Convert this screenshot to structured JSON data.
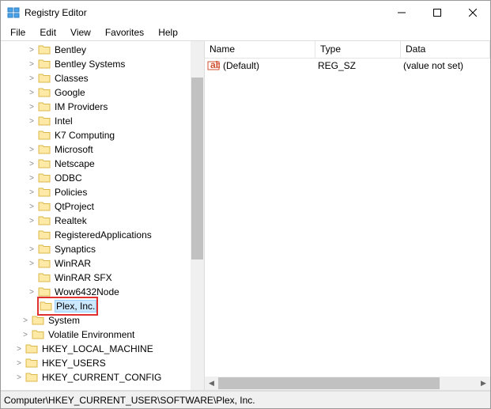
{
  "window": {
    "title": "Registry Editor"
  },
  "menu": {
    "file": "File",
    "edit": "Edit",
    "view": "View",
    "favorites": "Favorites",
    "help": "Help"
  },
  "tree": {
    "items": [
      {
        "label": "Bentley",
        "expandable": true,
        "depth": 4,
        "last": false
      },
      {
        "label": "Bentley Systems",
        "expandable": true,
        "depth": 4,
        "last": false
      },
      {
        "label": "Classes",
        "expandable": true,
        "depth": 4,
        "last": false
      },
      {
        "label": "Google",
        "expandable": true,
        "depth": 4,
        "last": false
      },
      {
        "label": "IM Providers",
        "expandable": true,
        "depth": 4,
        "last": false
      },
      {
        "label": "Intel",
        "expandable": true,
        "depth": 4,
        "last": false
      },
      {
        "label": "K7 Computing",
        "expandable": false,
        "depth": 4,
        "last": false
      },
      {
        "label": "Microsoft",
        "expandable": true,
        "depth": 4,
        "last": false
      },
      {
        "label": "Netscape",
        "expandable": true,
        "depth": 4,
        "last": false
      },
      {
        "label": "ODBC",
        "expandable": true,
        "depth": 4,
        "last": false
      },
      {
        "label": "Policies",
        "expandable": true,
        "depth": 4,
        "last": false
      },
      {
        "label": "QtProject",
        "expandable": true,
        "depth": 4,
        "last": false
      },
      {
        "label": "Realtek",
        "expandable": true,
        "depth": 4,
        "last": false
      },
      {
        "label": "RegisteredApplications",
        "expandable": false,
        "depth": 4,
        "last": false
      },
      {
        "label": "Synaptics",
        "expandable": true,
        "depth": 4,
        "last": false
      },
      {
        "label": "WinRAR",
        "expandable": true,
        "depth": 4,
        "last": false
      },
      {
        "label": "WinRAR SFX",
        "expandable": false,
        "depth": 4,
        "last": false
      },
      {
        "label": "Wow6432Node",
        "expandable": true,
        "depth": 4,
        "last": false
      },
      {
        "label": "Plex, Inc.",
        "expandable": false,
        "depth": 4,
        "last": true,
        "selected": true,
        "highlight": true
      },
      {
        "label": "System",
        "expandable": true,
        "depth": 3,
        "last": false
      },
      {
        "label": "Volatile Environment",
        "expandable": true,
        "depth": 3,
        "last": true
      },
      {
        "label": "HKEY_LOCAL_MACHINE",
        "expandable": true,
        "depth": 2,
        "last": false
      },
      {
        "label": "HKEY_USERS",
        "expandable": true,
        "depth": 2,
        "last": false
      },
      {
        "label": "HKEY_CURRENT_CONFIG",
        "expandable": true,
        "depth": 2,
        "last": true
      }
    ]
  },
  "list": {
    "headers": {
      "name": "Name",
      "type": "Type",
      "data": "Data"
    },
    "rows": [
      {
        "name": "(Default)",
        "type": "REG_SZ",
        "data": "(value not set)"
      }
    ]
  },
  "statusbar": {
    "path": "Computer\\HKEY_CURRENT_USER\\SOFTWARE\\Plex, Inc."
  }
}
